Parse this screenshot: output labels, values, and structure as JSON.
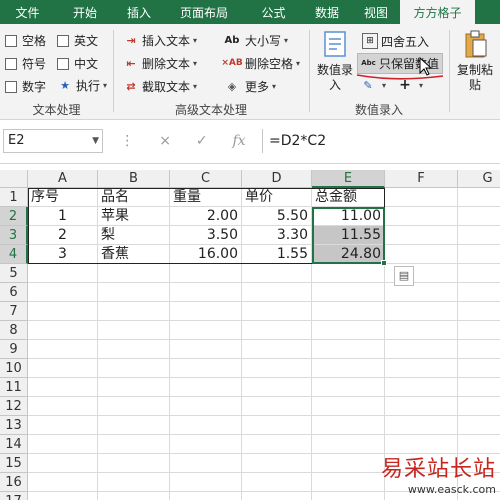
{
  "tabs": [
    "文件",
    "开始",
    "插入",
    "页面布局",
    "公式",
    "数据",
    "视图",
    "方方格子"
  ],
  "ribbon": {
    "checkbox_group": {
      "items": [
        {
          "label": "空格",
          "checked": false
        },
        {
          "label": "英文",
          "checked": false
        },
        {
          "label": "符号",
          "checked": false
        },
        {
          "label": "中文",
          "checked": false
        },
        {
          "label": "数字",
          "checked": false
        }
      ],
      "execute_label": "执行",
      "group_label": "文本处理"
    },
    "advanced_text": {
      "insert_text": "插入文本",
      "delete_text": "删除文本",
      "extract_text": "截取文本",
      "case": "大小写",
      "delete_spaces": "删除空格",
      "more": "更多",
      "group_label": "高级文本处理"
    },
    "number_entry": {
      "entry_label": "数值录\n入",
      "round_label": "四舍五入",
      "keep_value_label": "只保留数值",
      "group_label": "数值录入"
    },
    "paste_label": "复制粘\n贴"
  },
  "formula_bar": {
    "cell_ref": "E2",
    "cancel_icon": "×",
    "confirm_icon": "✓",
    "fx_label": "fx",
    "formula": "=D2*C2"
  },
  "sheet": {
    "columns": [
      "A",
      "B",
      "C",
      "D",
      "E",
      "F",
      "G"
    ],
    "rows": [
      "1",
      "2",
      "3",
      "4",
      "5",
      "6",
      "7",
      "8",
      "9",
      "10",
      "11",
      "12",
      "13",
      "14",
      "15",
      "16",
      "17"
    ],
    "data": [
      [
        "序号",
        "品名",
        "重量",
        "单价",
        "总金额"
      ],
      [
        "1",
        "苹果",
        "2.00",
        "5.50",
        "11.00"
      ],
      [
        "2",
        "梨",
        "3.50",
        "3.30",
        "11.55"
      ],
      [
        "3",
        "香蕉",
        "16.00",
        "1.55",
        "24.80"
      ]
    ],
    "selected_column": "E",
    "selected_rows": [
      "2",
      "3",
      "4"
    ]
  },
  "watermark": {
    "title": "易采站长站",
    "url": "www.easck.com"
  },
  "colors": {
    "accent": "#217346",
    "watermark": "#c8251f"
  }
}
